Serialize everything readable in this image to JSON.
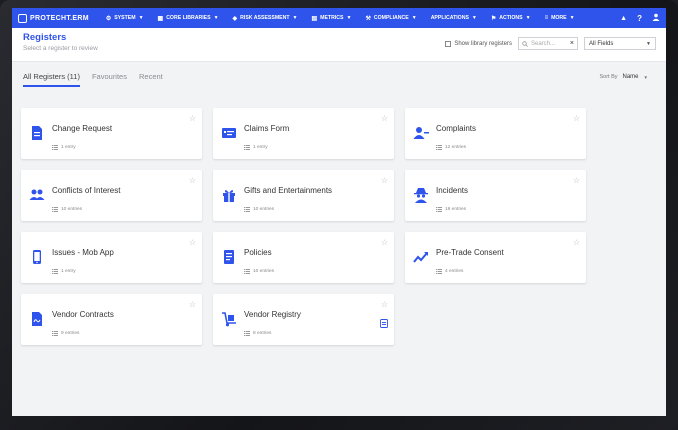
{
  "app": {
    "logo": "PROTECHT.ERM"
  },
  "nav": {
    "items": [
      {
        "label": "System",
        "icon": "gear-icon",
        "glyph": "⚙"
      },
      {
        "label": "Core Libraries",
        "icon": "library-icon",
        "glyph": "▦"
      },
      {
        "label": "Risk Assessment",
        "icon": "risk-icon",
        "glyph": "◆"
      },
      {
        "label": "Metrics",
        "icon": "metrics-icon",
        "glyph": "▤"
      },
      {
        "label": "Compliance",
        "icon": "compliance-icon",
        "glyph": "⚒"
      },
      {
        "label": "Applications",
        "icon": "applications-icon",
        "glyph": ""
      },
      {
        "label": "Actions",
        "icon": "flag-icon",
        "glyph": "⚑"
      },
      {
        "label": "More",
        "icon": "menu-icon",
        "glyph": "≡"
      }
    ],
    "right": {
      "grad": "🎓",
      "help": "?",
      "user": "👤"
    }
  },
  "header": {
    "title": "Registers",
    "subtitle": "Select a register to review",
    "show_library_label": "Show library registers",
    "search_placeholder": "Search...",
    "fields_value": "All Fields"
  },
  "tabs": [
    {
      "label": "All Registers (11)",
      "active": true
    },
    {
      "label": "Favourites",
      "active": false
    },
    {
      "label": "Recent",
      "active": false
    }
  ],
  "sort": {
    "label": "Sort By",
    "value": "Name"
  },
  "colors": {
    "accent": "#2f54eb"
  },
  "registers": [
    {
      "name": "Change Request",
      "entries": "1 entry",
      "icon": "document-icon"
    },
    {
      "name": "Claims Form",
      "entries": "1 entry",
      "icon": "card-icon"
    },
    {
      "name": "Complaints",
      "entries": "12 entries",
      "icon": "user-minus-icon"
    },
    {
      "name": "Conflicts of Interest",
      "entries": "10 entries",
      "icon": "users-icon"
    },
    {
      "name": "Gifts and Entertainments",
      "entries": "10 entries",
      "icon": "gift-icon"
    },
    {
      "name": "Incidents",
      "entries": "19 entries",
      "icon": "spy-icon"
    },
    {
      "name": "Issues - Mob App",
      "entries": "1 entry",
      "icon": "mobile-icon"
    },
    {
      "name": "Policies",
      "entries": "10 entries",
      "icon": "book-icon"
    },
    {
      "name": "Pre-Trade Consent",
      "entries": "4 entries",
      "icon": "trend-icon"
    },
    {
      "name": "Vendor Contracts",
      "entries": "9 entries",
      "icon": "contract-icon"
    },
    {
      "name": "Vendor Registry",
      "entries": "8 entries",
      "icon": "dolly-icon"
    }
  ]
}
